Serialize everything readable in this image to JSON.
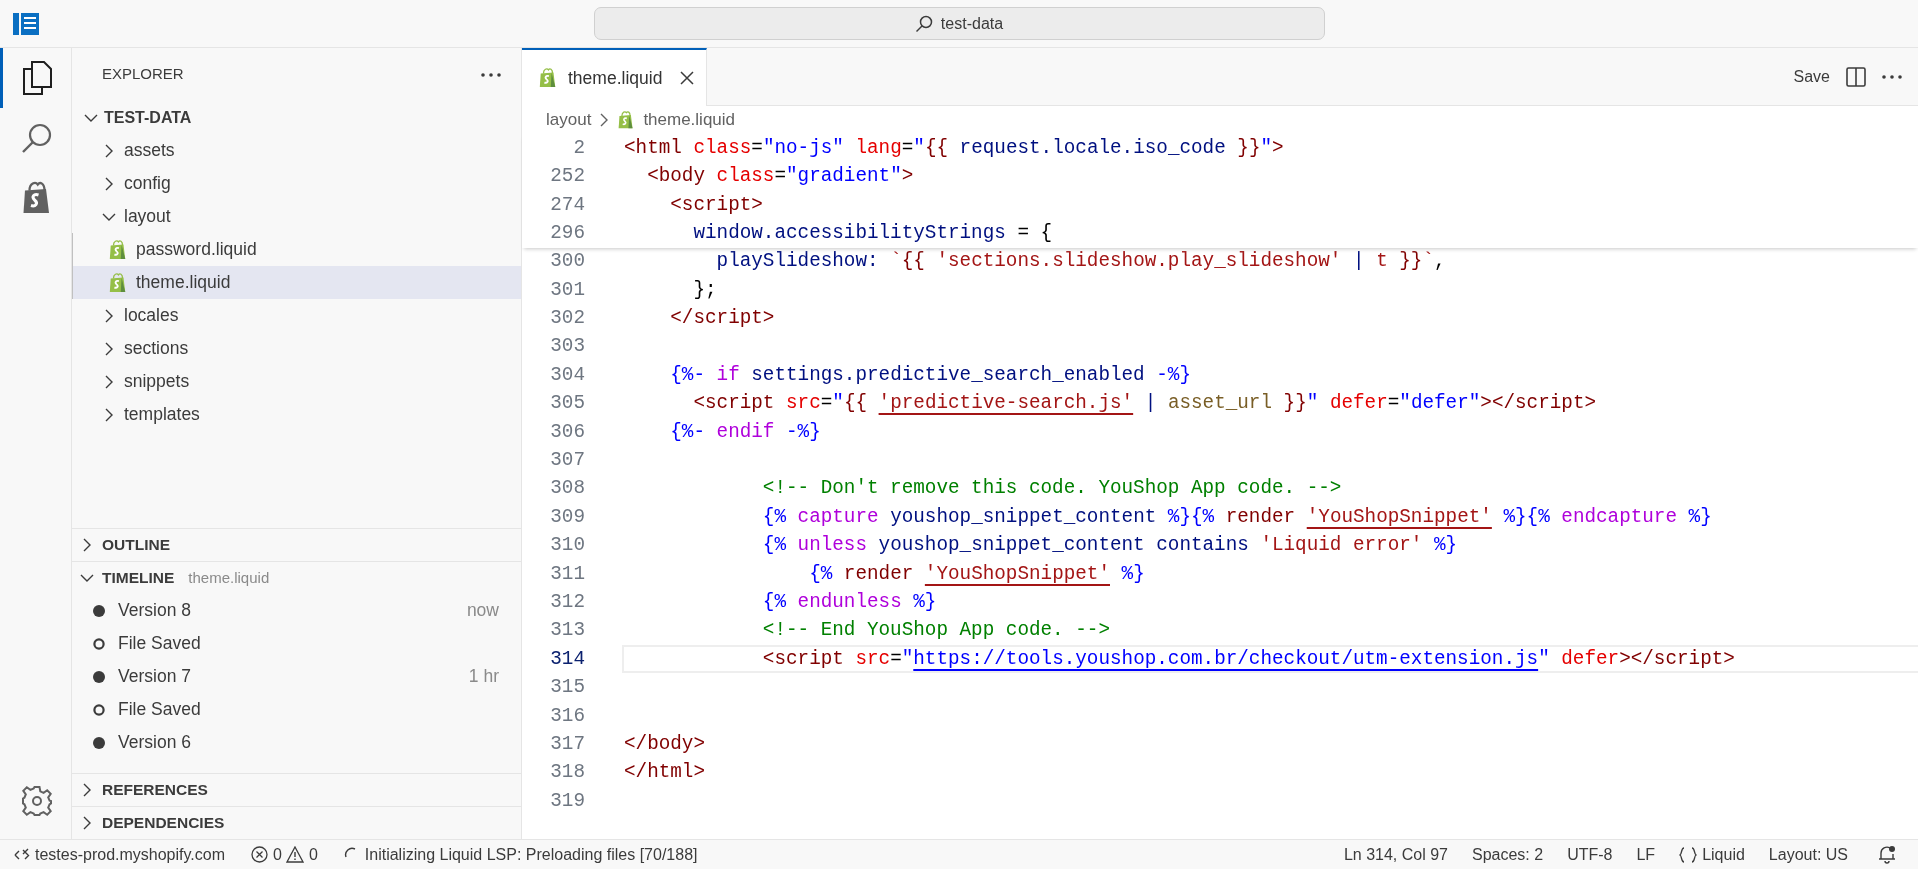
{
  "title_bar": {
    "search": "test-data"
  },
  "activity_bar": [
    {
      "kind": "explorer",
      "selected": true
    },
    {
      "kind": "search",
      "selected": false
    },
    {
      "kind": "shopify",
      "selected": false
    },
    {
      "kind": "settings",
      "selected": false
    }
  ],
  "sidebar": {
    "title": "EXPLORER",
    "tree": {
      "label": "TEST-DATA",
      "expanded": true,
      "children": [
        {
          "label": "assets",
          "kind": "folder",
          "expanded": false,
          "selected": false
        },
        {
          "label": "config",
          "kind": "folder",
          "expanded": false,
          "selected": false
        },
        {
          "label": "layout",
          "kind": "folder",
          "expanded": true,
          "selected": false,
          "children": [
            {
              "label": "password.liquid",
              "kind": "file",
              "selected": false
            },
            {
              "label": "theme.liquid",
              "kind": "file",
              "selected": true
            }
          ]
        },
        {
          "label": "locales",
          "kind": "folder",
          "expanded": false,
          "selected": false
        },
        {
          "label": "sections",
          "kind": "folder",
          "expanded": false,
          "selected": false
        },
        {
          "label": "snippets",
          "kind": "folder",
          "expanded": false,
          "selected": false
        },
        {
          "label": "templates",
          "kind": "folder",
          "expanded": false,
          "selected": false
        }
      ]
    },
    "panels": [
      {
        "label": "OUTLINE",
        "expanded": false
      },
      {
        "label": "TIMELINE",
        "subtitle": "theme.liquid",
        "expanded": true,
        "entries": [
          {
            "label": "Version 8",
            "kind": "version",
            "time": "now"
          },
          {
            "label": "File Saved",
            "kind": "save"
          },
          {
            "label": "Version 7",
            "kind": "version",
            "time": "1 hr"
          },
          {
            "label": "File Saved",
            "kind": "save"
          },
          {
            "label": "Version 6",
            "kind": "version"
          }
        ]
      },
      {
        "label": "REFERENCES",
        "expanded": false
      },
      {
        "label": "DEPENDENCIES",
        "expanded": false
      }
    ]
  },
  "editor": {
    "tabs": [
      {
        "label": "theme.liquid",
        "selected": true
      }
    ],
    "save": "Save",
    "breadcrumb": [
      "layout",
      "theme.liquid"
    ],
    "sticky_lines": [
      {
        "number": "2",
        "tokens": [
          {
            "kind": "tag",
            "text": "<html"
          },
          {
            "kind": "attr",
            "text": " class"
          },
          {
            "kind": "punct",
            "text": "="
          },
          {
            "kind": "string",
            "text": "\"no-js\""
          },
          {
            "kind": "attr",
            "text": " lang"
          },
          {
            "kind": "punct",
            "text": "="
          },
          {
            "kind": "string",
            "text": "\""
          },
          {
            "kind": "output",
            "text": "{{"
          },
          {
            "kind": "variable",
            "text": " request.locale.iso_code "
          },
          {
            "kind": "output",
            "text": "}}"
          },
          {
            "kind": "string",
            "text": "\""
          },
          {
            "kind": "tag",
            "text": ">"
          }
        ]
      },
      {
        "number": "252",
        "tokens": [
          {
            "kind": "tag",
            "text": "  <body"
          },
          {
            "kind": "attr",
            "text": " class"
          },
          {
            "kind": "punct",
            "text": "="
          },
          {
            "kind": "string",
            "text": "\"gradient\""
          },
          {
            "kind": "tag",
            "text": ">"
          }
        ]
      },
      {
        "number": "274",
        "tokens": [
          {
            "kind": "tag",
            "text": "    <script>"
          }
        ]
      },
      {
        "number": "296",
        "tokens": [
          {
            "kind": "variable",
            "text": "      window.accessibilityStrings "
          },
          {
            "kind": "punct",
            "text": "= {"
          }
        ]
      }
    ],
    "lines": [
      {
        "number": "300",
        "current": false,
        "tokens": [
          {
            "kind": "variable",
            "text": "        playSlideshow: "
          },
          {
            "kind": "literal",
            "text": "`"
          },
          {
            "kind": "output",
            "text": "{{"
          },
          {
            "kind": "literal",
            "text": " 'sections.slideshow.play_slideshow' "
          },
          {
            "kind": "variable",
            "text": "|"
          },
          {
            "kind": "literal",
            "text": " t "
          },
          {
            "kind": "output",
            "text": "}}"
          },
          {
            "kind": "literal",
            "text": "`"
          },
          {
            "kind": "punct",
            "text": ","
          }
        ]
      },
      {
        "number": "301",
        "current": false,
        "tokens": [
          {
            "kind": "punct",
            "text": "      };"
          }
        ]
      },
      {
        "number": "302",
        "current": false,
        "tokens": [
          {
            "kind": "tag",
            "text": "    </script>"
          }
        ]
      },
      {
        "number": "303",
        "current": false
      },
      {
        "number": "304",
        "current": false,
        "tokens": [
          {
            "kind": "delimiter",
            "text": "    {%-"
          },
          {
            "kind": "keyword",
            "text": " if"
          },
          {
            "kind": "variable",
            "text": " settings.predictive_search_enabled"
          },
          {
            "kind": "delimiter",
            "text": " -%}"
          }
        ]
      },
      {
        "number": "305",
        "current": false,
        "tokens": [
          {
            "kind": "tag",
            "text": "      <script"
          },
          {
            "kind": "attr",
            "text": " src"
          },
          {
            "kind": "punct",
            "text": "="
          },
          {
            "kind": "string",
            "text": "\""
          },
          {
            "kind": "output",
            "text": "{{ "
          },
          {
            "kind": "error-literal",
            "text": "'predictive-search.js'"
          },
          {
            "kind": "variable",
            "text": " | "
          },
          {
            "kind": "filter",
            "text": "asset_url"
          },
          {
            "kind": "output",
            "text": " }}"
          },
          {
            "kind": "string",
            "text": "\""
          },
          {
            "kind": "attr",
            "text": " defer"
          },
          {
            "kind": "punct",
            "text": "="
          },
          {
            "kind": "string",
            "text": "\"defer\""
          },
          {
            "kind": "tag",
            "text": "></script>"
          }
        ]
      },
      {
        "number": "306",
        "current": false,
        "tokens": [
          {
            "kind": "delimiter",
            "text": "    {%-"
          },
          {
            "kind": "keyword",
            "text": " endif"
          },
          {
            "kind": "delimiter",
            "text": " -%}"
          }
        ]
      },
      {
        "number": "307",
        "current": false
      },
      {
        "number": "308",
        "current": false,
        "tokens": [
          {
            "kind": "comment",
            "text": "            <!-- Don't remove this code. YouShop App code. -->"
          }
        ]
      },
      {
        "number": "309",
        "current": false,
        "tokens": [
          {
            "kind": "delimiter",
            "text": "            {%"
          },
          {
            "kind": "keyword",
            "text": " capture"
          },
          {
            "kind": "variable",
            "text": " youshop_snippet_content "
          },
          {
            "kind": "delimiter",
            "text": "%}{%"
          },
          {
            "kind": "tag",
            "text": " render "
          },
          {
            "kind": "error-literal",
            "text": "'YouShopSnippet'"
          },
          {
            "kind": "delimiter",
            "text": " %}{%"
          },
          {
            "kind": "keyword",
            "text": " endcapture"
          },
          {
            "kind": "delimiter",
            "text": " %}"
          }
        ]
      },
      {
        "number": "310",
        "current": false,
        "tokens": [
          {
            "kind": "delimiter",
            "text": "            {%"
          },
          {
            "kind": "keyword",
            "text": " unless"
          },
          {
            "kind": "variable",
            "text": " youshop_snippet_content contains "
          },
          {
            "kind": "literal",
            "text": "'Liquid error'"
          },
          {
            "kind": "delimiter",
            "text": " %}"
          }
        ]
      },
      {
        "number": "311",
        "current": false,
        "tokens": [
          {
            "kind": "delimiter",
            "text": "                {%"
          },
          {
            "kind": "tag",
            "text": " render "
          },
          {
            "kind": "error-literal",
            "text": "'YouShopSnippet'"
          },
          {
            "kind": "delimiter",
            "text": " %}"
          }
        ]
      },
      {
        "number": "312",
        "current": false,
        "tokens": [
          {
            "kind": "delimiter",
            "text": "            {%"
          },
          {
            "kind": "keyword",
            "text": " endunless"
          },
          {
            "kind": "delimiter",
            "text": " %}"
          }
        ]
      },
      {
        "number": "313",
        "current": false,
        "tokens": [
          {
            "kind": "comment",
            "text": "            <!-- End YouShop App code. -->"
          }
        ]
      },
      {
        "number": "314",
        "current": true,
        "tokens": [
          {
            "kind": "tag",
            "text": "            <script"
          },
          {
            "kind": "attr",
            "text": " src"
          },
          {
            "kind": "punct",
            "text": "="
          },
          {
            "kind": "string",
            "text": "\""
          },
          {
            "kind": "link",
            "text": "https://tools.youshop.com.br/checkout/utm-extension.js"
          },
          {
            "kind": "string",
            "text": "\""
          },
          {
            "kind": "attr",
            "text": " defer"
          },
          {
            "kind": "tag",
            "text": "></script>"
          }
        ]
      },
      {
        "number": "315",
        "current": false
      },
      {
        "number": "316",
        "current": false
      },
      {
        "number": "317",
        "current": false,
        "tokens": [
          {
            "kind": "tag",
            "text": "</body>"
          }
        ]
      },
      {
        "number": "318",
        "current": false,
        "tokens": [
          {
            "kind": "tag",
            "text": "</html>"
          }
        ]
      },
      {
        "number": "319",
        "current": false
      }
    ]
  },
  "status_bar": {
    "remote": "testes-prod.myshopify.com",
    "errors": "0",
    "warnings": "0",
    "progress": "Initializing Liquid LSP: Preloading files [70/188]",
    "position": "Ln 314, Col 97",
    "indentation": "Spaces: 2",
    "encoding": "UTF-8",
    "eol": "LF",
    "language": "Liquid",
    "layout": "Layout: US"
  }
}
